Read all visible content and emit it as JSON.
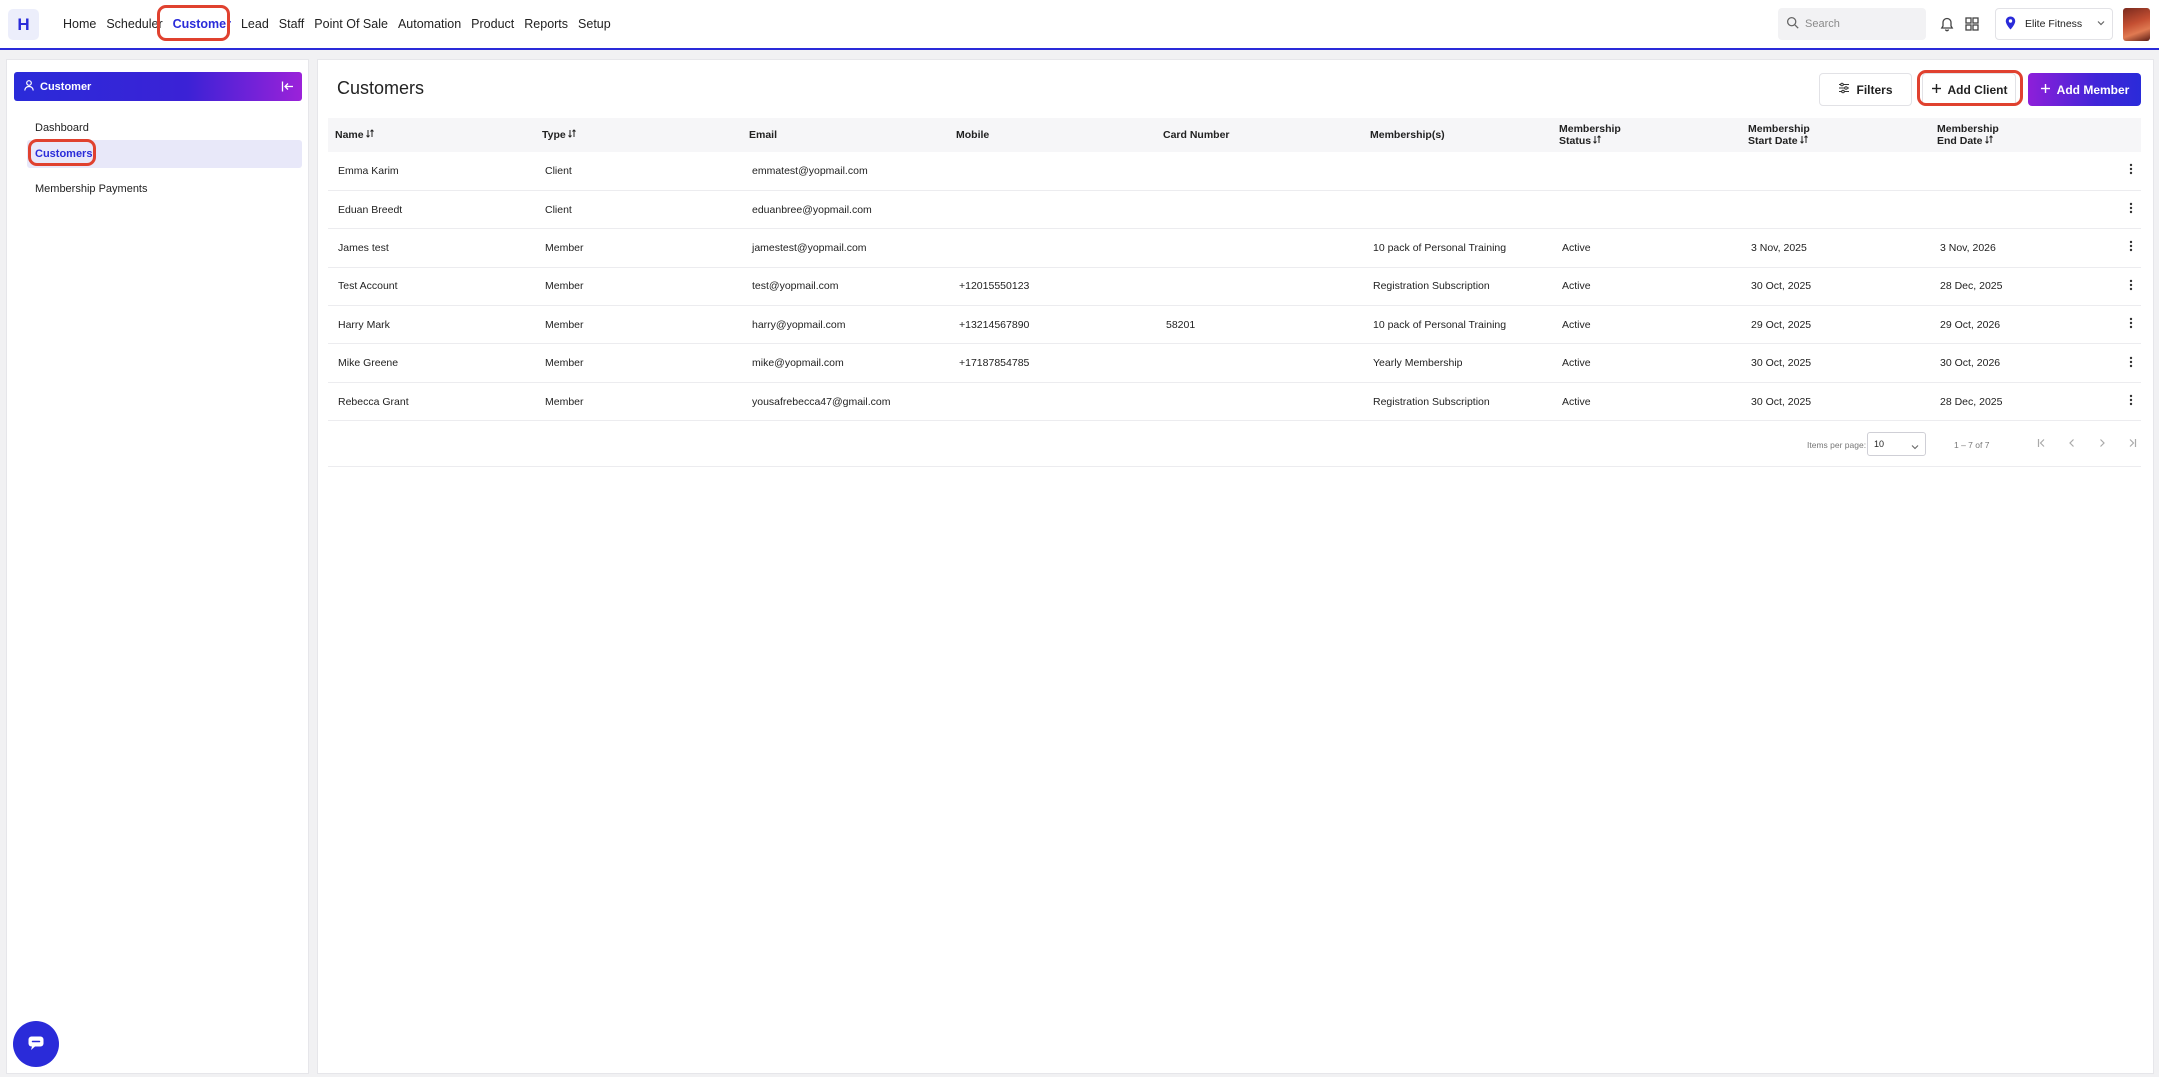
{
  "header": {
    "logo": "H",
    "nav": [
      "Home",
      "Scheduler",
      "Customer",
      "Lead",
      "Staff",
      "Point Of Sale",
      "Automation",
      "Product",
      "Reports",
      "Setup"
    ],
    "search_placeholder": "Search",
    "location": "Elite Fitness",
    "active_nav": "Customer"
  },
  "sidebar": {
    "title": "Customer",
    "items": [
      "Dashboard",
      "Customers",
      "Membership Payments"
    ],
    "active_item": "Customers"
  },
  "main": {
    "title": "Customers",
    "buttons": {
      "filters": "Filters",
      "add_client": "Add Client",
      "add_member": "Add Member"
    },
    "columns": [
      {
        "line1": "Name",
        "line2": "",
        "sortable": true
      },
      {
        "line1": "Type",
        "line2": "",
        "sortable": true
      },
      {
        "line1": "Email",
        "line2": "",
        "sortable": false
      },
      {
        "line1": "Mobile",
        "line2": "",
        "sortable": false
      },
      {
        "line1": "Card Number",
        "line2": "",
        "sortable": false
      },
      {
        "line1": "Membership(s)",
        "line2": "",
        "sortable": false
      },
      {
        "line1": "Membership",
        "line2": "Status",
        "sortable": true
      },
      {
        "line1": "Membership",
        "line2": "Start Date",
        "sortable": true
      },
      {
        "line1": "Membership",
        "line2": "End Date",
        "sortable": true
      }
    ],
    "rows": [
      [
        "Emma Karim",
        "Client",
        "emmatest@yopmail.com",
        "",
        "",
        "",
        "",
        "",
        ""
      ],
      [
        "Eduan Breedt",
        "Client",
        "eduanbree@yopmail.com",
        "",
        "",
        "",
        "",
        "",
        ""
      ],
      [
        "James test",
        "Member",
        "jamestest@yopmail.com",
        "",
        "",
        "10 pack of Personal Training",
        "Active",
        "3 Nov, 2025",
        "3 Nov, 2026"
      ],
      [
        "Test Account",
        "Member",
        "test@yopmail.com",
        "+12015550123",
        "",
        "Registration Subscription",
        "Active",
        "30 Oct, 2025",
        "28 Dec, 2025"
      ],
      [
        "Harry Mark",
        "Member",
        "harry@yopmail.com",
        "+13214567890",
        "58201",
        "10 pack of Personal Training",
        "Active",
        "29 Oct, 2025",
        "29 Oct, 2026"
      ],
      [
        "Mike Greene",
        "Member",
        "mike@yopmail.com",
        "+17187854785",
        "",
        "Yearly Membership",
        "Active",
        "30 Oct, 2025",
        "30 Oct, 2026"
      ],
      [
        "Rebecca Grant",
        "Member",
        "yousafrebecca47@gmail.com",
        "",
        "",
        "Registration Subscription",
        "Active",
        "30 Oct, 2025",
        "28 Dec, 2025"
      ]
    ],
    "pagination": {
      "items_per_page_label": "Items per page:",
      "items_per_page": "10",
      "range": "1 – 7 of 7"
    }
  },
  "colors": {
    "accent": "#2a2bd9",
    "accent_purple": "#8e1fd9",
    "highlight_ring": "#e0412f"
  },
  "icons": [
    "search-icon",
    "bell-icon",
    "apps-grid-icon",
    "location-pin-icon",
    "chevron-down-icon",
    "user-icon",
    "collapse-sidebar-icon",
    "filter-icon",
    "plus-icon",
    "more-vertical-icon",
    "first-page-icon",
    "prev-page-icon",
    "next-page-icon",
    "last-page-icon",
    "chat-icon",
    "sort-icon"
  ]
}
